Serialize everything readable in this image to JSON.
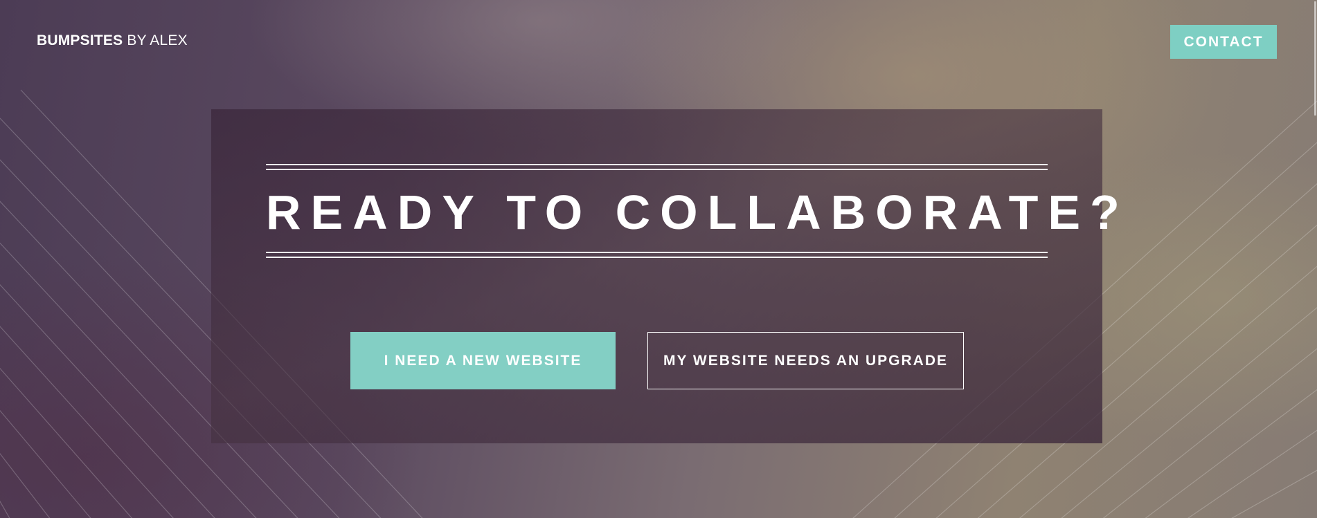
{
  "header": {
    "logo_brand": "BUMPSITES",
    "logo_suffix": " BY ALEX",
    "contact_label": "CONTACT"
  },
  "hero": {
    "headline": "READY TO COLLABORATE?",
    "primary_button": "I NEED A NEW WEBSITE",
    "secondary_button": "MY WEBSITE NEEDS AN UPGRADE"
  },
  "colors": {
    "accent": "#83cfc4",
    "text": "#ffffff"
  }
}
